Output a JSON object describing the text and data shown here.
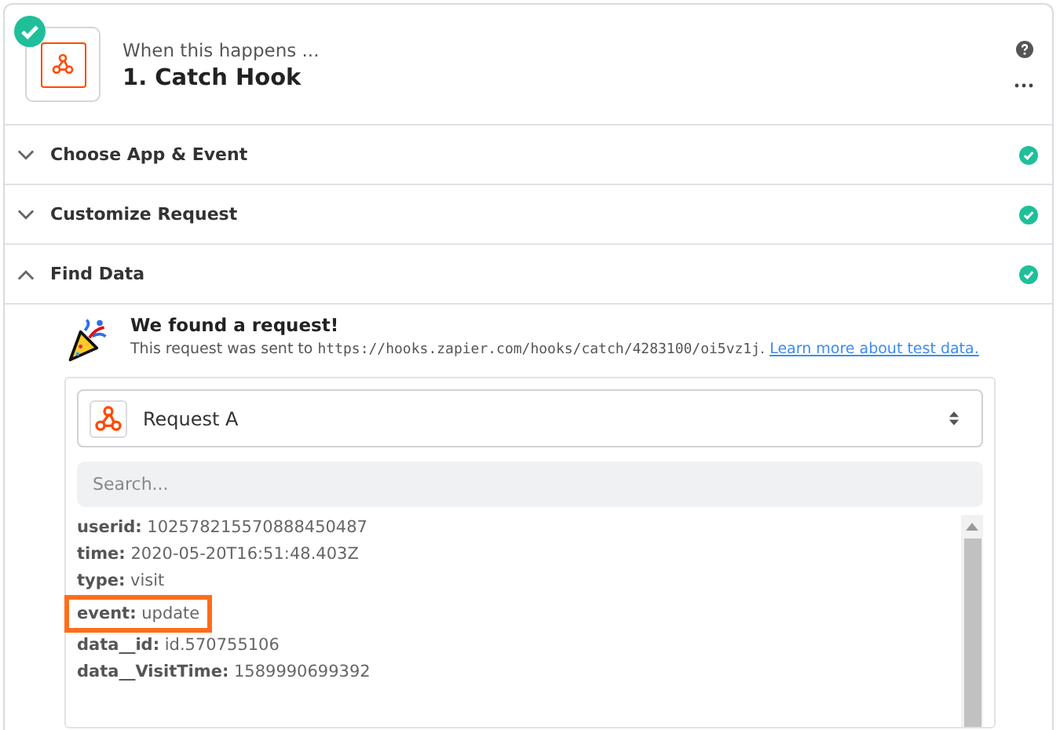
{
  "step": {
    "subtitle": "When this happens ...",
    "title": "1. Catch Hook",
    "complete": true
  },
  "sections": [
    {
      "label": "Choose App & Event",
      "expanded": false,
      "complete": true
    },
    {
      "label": "Customize Request",
      "expanded": false,
      "complete": true
    },
    {
      "label": "Find Data",
      "expanded": true,
      "complete": true
    }
  ],
  "found": {
    "heading": "We found a request!",
    "text": "This request was sent to ",
    "url": "https://hooks.zapier.com/hooks/catch/4283100/oi5vz1j",
    "after": ". ",
    "link": "Learn more about test data."
  },
  "request_select": {
    "value": "Request A"
  },
  "search": {
    "placeholder": "Search..."
  },
  "fields": [
    {
      "key": "userid:",
      "value": "102578215570888450487",
      "highlighted": false
    },
    {
      "key": "time:",
      "value": "2020-05-20T16:51:48.403Z",
      "highlighted": false
    },
    {
      "key": "type:",
      "value": "visit",
      "highlighted": false
    },
    {
      "key": "event:",
      "value": "update",
      "highlighted": true
    },
    {
      "key": "data__id:",
      "value": "id.570755106",
      "highlighted": false
    },
    {
      "key": "data__VisitTime:",
      "value": "1589990699392",
      "highlighted": false
    }
  ]
}
